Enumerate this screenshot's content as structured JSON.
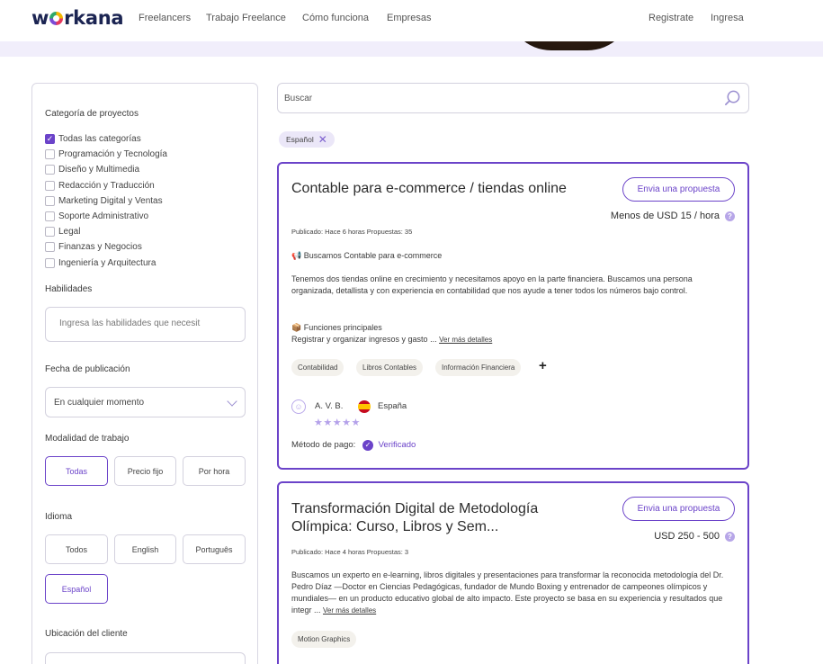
{
  "header": {
    "logo": "workana",
    "nav": [
      "Freelancers",
      "Trabajo Freelance",
      "Cómo funciona",
      "Empresas"
    ],
    "register": "Registrate",
    "login": "Ingresa"
  },
  "sidebar": {
    "categories_title": "Categoría de proyectos",
    "categories": [
      {
        "label": "Todas las categorías",
        "checked": true
      },
      {
        "label": "Programación y Tecnología",
        "checked": false
      },
      {
        "label": "Diseño y Multimedia",
        "checked": false
      },
      {
        "label": "Redacción y Traducción",
        "checked": false
      },
      {
        "label": "Marketing Digital y Ventas",
        "checked": false
      },
      {
        "label": "Soporte Administrativo",
        "checked": false
      },
      {
        "label": "Legal",
        "checked": false
      },
      {
        "label": "Finanzas y Negocios",
        "checked": false
      },
      {
        "label": "Ingeniería y Arquitectura",
        "checked": false
      }
    ],
    "skills_title": "Habilidades",
    "skills_placeholder": "Ingresa las habilidades que necesit",
    "date_title": "Fecha de publicación",
    "date_value": "En cualquier momento",
    "modality_title": "Modalidad de trabajo",
    "modality": [
      "Todas",
      "Precio fijo",
      "Por hora"
    ],
    "language_title": "Idioma",
    "languages": [
      "Todos",
      "English",
      "Português",
      "Español"
    ],
    "location_title": "Ubicación del cliente"
  },
  "search": {
    "placeholder": "Buscar"
  },
  "active_filter": "Español",
  "projects": [
    {
      "title": "Contable para e-commerce / tiendas online",
      "button": "Envia una propuesta",
      "price": "Menos de USD 15 / hora",
      "meta": "Publicado: Hace 6 horas  Propuestas: 35",
      "headline": "📢 Buscamos Contable para e-commerce",
      "body": "Tenemos dos tiendas online en crecimiento y necesitamos apoyo en la parte financiera. Buscamos una persona organizada, detallista y con experiencia en contabilidad que nos ayude a tener todos los números bajo control.",
      "section": "📦 Funciones principales",
      "section_body": "Registrar y organizar ingresos y gasto ...",
      "more": "Ver más detalles",
      "tags": [
        "Contabilidad",
        "Libros Contables",
        "Información Financiera"
      ],
      "client": "A. V. B.",
      "country": "España",
      "rating_stars": 5,
      "payment_label": "Método de pago:",
      "payment_status": "Verificado"
    },
    {
      "title": "Transformación Digital de Metodología Olímpica: Curso, Libros y Sem...",
      "button": "Envia una propuesta",
      "price": "USD 250 - 500",
      "meta": "Publicado: Hace 4 horas  Propuestas: 3",
      "body": "Buscamos un experto en e-learning, libros digitales y presentaciones para transformar la reconocida metodología del Dr. Pedro Díaz —Doctor en Ciencias Pedagógicas, fundador de Mundo Boxing y entrenador de campeones olímpicos y mundiales— en un producto educativo global de alto impacto. Este proyecto se basa en su experiencia y resultados que integr ...",
      "more": "Ver más detalles",
      "tags": [
        "Motion Graphics"
      ]
    }
  ]
}
